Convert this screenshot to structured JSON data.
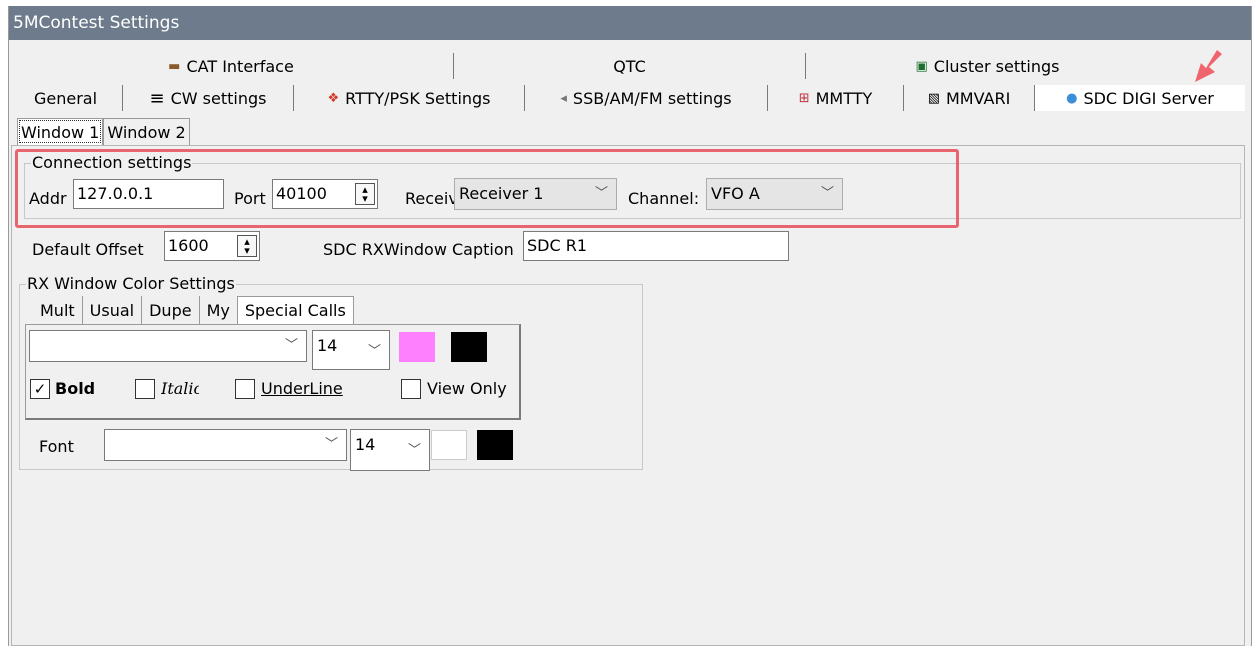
{
  "window": {
    "title": "5MContest Settings"
  },
  "tabs": {
    "row1": [
      {
        "label": "CAT Interface",
        "icon": "cat-interface-icon",
        "glyph": "▬"
      },
      {
        "label": "QTC",
        "icon": "",
        "glyph": ""
      },
      {
        "label": "Cluster settings",
        "icon": "cluster-icon",
        "glyph": "▣"
      }
    ],
    "row2": [
      {
        "label": "General",
        "icon": "",
        "glyph": ""
      },
      {
        "label": "CW settings",
        "icon": "cw-icon",
        "glyph": "≡"
      },
      {
        "label": "RTTY/PSK Settings",
        "icon": "rtty-icon",
        "glyph": "❖"
      },
      {
        "label": "SSB/AM/FM settings",
        "icon": "speaker-icon",
        "glyph": "◂"
      },
      {
        "label": "MMTTY",
        "icon": "mmtty-icon",
        "glyph": "⊞"
      },
      {
        "label": "MMVARI",
        "icon": "mmvari-icon",
        "glyph": "▧"
      },
      {
        "label": "SDC DIGI Server",
        "icon": "sdc-icon",
        "glyph": "●"
      }
    ],
    "active_row2_index": 6
  },
  "subtabs": [
    "Window 1",
    "Window 2"
  ],
  "connection": {
    "group_label": "Connection settings",
    "addr_label": "Addr",
    "addr_value": "127.0.0.1",
    "port_label": "Port",
    "port_value": "40100",
    "receiver_label": "Receiver:",
    "receiver_value": "Receiver 1",
    "channel_label": "Channel:",
    "channel_value": "VFO A"
  },
  "default_offset": {
    "label": "Default Offset",
    "value": "1600"
  },
  "caption": {
    "label": "SDC RXWindow Caption",
    "value": "SDC R1"
  },
  "rx_color": {
    "group_label": "RX Window Color Settings",
    "tabs": [
      "Mult",
      "Usual",
      "Dupe",
      "My",
      "Special Calls"
    ],
    "active_tab_index": 4,
    "font_combo_value": "",
    "size_value": "14",
    "color1": "#ff80ff",
    "color2": "#000000",
    "bold_label": "Bold",
    "bold_checked": true,
    "italic_label": "Italic",
    "italic_checked": false,
    "underline_label": "UnderLine",
    "underline_checked": false,
    "viewonly_label": "View Only",
    "viewonly_checked": false,
    "font_label": "Font",
    "font_value": "",
    "font_size_value": "14",
    "font_color1": "#ffffff",
    "font_color2": "#000000"
  },
  "colors": {
    "titlebar": "#6d7b8d",
    "highlight": "#e8646e",
    "arrow": "#f0646e",
    "sdc_icon": "#3a8fd8"
  }
}
